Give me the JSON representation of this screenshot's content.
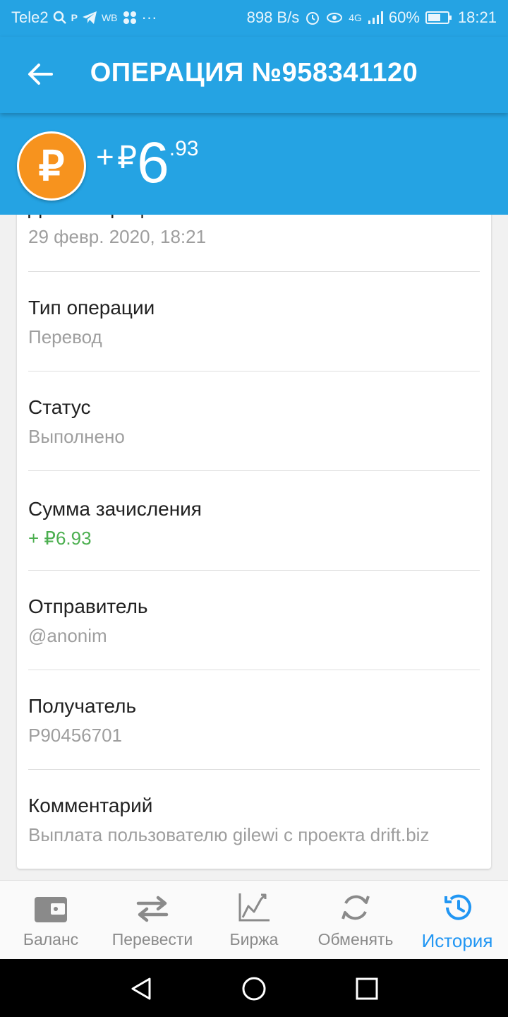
{
  "status_bar": {
    "carrier": "Tele2",
    "speed": "898 B/s",
    "network": "4G",
    "battery": "60%",
    "time": "18:21"
  },
  "header": {
    "title": "ОПЕРАЦИЯ №958341120"
  },
  "amount": {
    "sign": "+",
    "currency": "₽",
    "main": "6",
    "cents": ".93",
    "coin_symbol": "₽"
  },
  "details": [
    {
      "label": "Дата операции",
      "value": "29 февр. 2020, 18:21"
    },
    {
      "label": "Тип операции",
      "value": "Перевод"
    },
    {
      "label": "Статус",
      "value": "Выполнено"
    },
    {
      "label": "Сумма зачисления",
      "value": "+ ₽6.93",
      "value_color": "#4caf50"
    },
    {
      "label": "Отправитель",
      "value": "@anonim"
    },
    {
      "label": "Получатель",
      "value": "P90456701"
    },
    {
      "label": "Комментарий",
      "value": "Выплата пользователю gilewi с проекта drift.biz"
    }
  ],
  "bottom_nav": [
    {
      "label": "Баланс",
      "icon": "wallet-icon"
    },
    {
      "label": "Перевести",
      "icon": "transfer-arrows-icon"
    },
    {
      "label": "Биржа",
      "icon": "chart-icon"
    },
    {
      "label": "Обменять",
      "icon": "refresh-icon"
    },
    {
      "label": "История",
      "icon": "history-icon",
      "active": true
    }
  ],
  "colors": {
    "primary": "#25a3e3",
    "coin": "#f7931e",
    "active_nav": "#2196f3",
    "positive": "#4caf50"
  }
}
